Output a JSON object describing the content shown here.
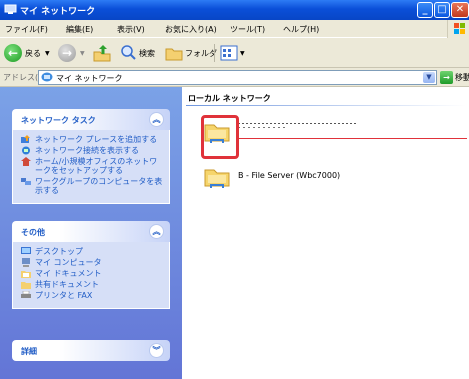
{
  "window": {
    "title": "マイ ネットワーク",
    "minimize_glyph": "_",
    "maximize_glyph": "□",
    "close_glyph": "✕"
  },
  "menu": [
    "ファイル(F)",
    "編集(E)",
    "表示(V)",
    "お気に入り(A)",
    "ツール(T)",
    "ヘルプ(H)"
  ],
  "toolbar": {
    "back_label": "戻る",
    "search_label": "検索",
    "folders_label": "フォルダ"
  },
  "address": {
    "label": "アドレス(D)",
    "value": "マイ ネットワーク",
    "go_label": "移動"
  },
  "left": {
    "panels": [
      {
        "title": "ネットワーク タスク",
        "collapsed": false,
        "items": [
          "ネットワーク プレースを追加する",
          "ネットワーク接続を表示する",
          "ホーム/小規模オフィスのネットワークをセットアップする",
          "ワークグループのコンピュータを表示する"
        ]
      },
      {
        "title": "その他",
        "collapsed": false,
        "items": [
          "デスクトップ",
          "マイ コンピュータ",
          "マイ ドキュメント",
          "共有ドキュメント",
          "プリンタと FAX"
        ]
      },
      {
        "title": "詳細",
        "collapsed": true,
        "items": []
      }
    ]
  },
  "right": {
    "group_title": "ローカル ネットワーク",
    "items": [
      {
        "label": ""
      },
      {
        "label": "B - File Server (Wbc7000)"
      }
    ]
  },
  "colors": {
    "title_bar": "#0a4fd8",
    "task_pane": "#6f8fe0",
    "highlight": "#e0323a"
  }
}
